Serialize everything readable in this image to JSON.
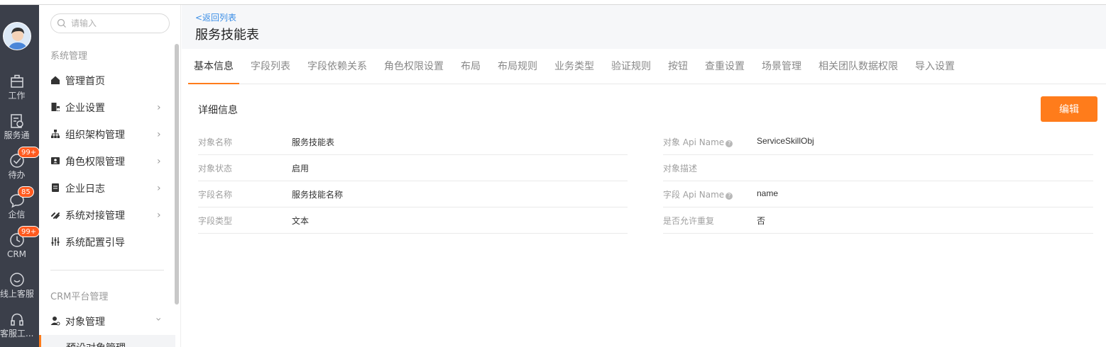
{
  "rail": {
    "items": [
      {
        "label": "工作",
        "icon": "briefcase-icon"
      },
      {
        "label": "服务通",
        "icon": "service-icon"
      },
      {
        "label": "待办",
        "icon": "todo-icon",
        "badge": "99+"
      },
      {
        "label": "企信",
        "icon": "chat-icon",
        "badge": "85"
      },
      {
        "label": "CRM",
        "icon": "crm-icon",
        "badge": "99+"
      },
      {
        "label": "线上客服",
        "icon": "smile-icon"
      },
      {
        "label": "客服工...",
        "icon": "headset-icon"
      }
    ]
  },
  "sidebar": {
    "search_placeholder": "请输入",
    "group1": "系统管理",
    "items": [
      {
        "label": "管理首页",
        "icon": "home-icon"
      },
      {
        "label": "企业设置",
        "icon": "building-icon"
      },
      {
        "label": "组织架构管理",
        "icon": "org-chart-icon"
      },
      {
        "label": "角色权限管理",
        "icon": "id-card-icon"
      },
      {
        "label": "企业日志",
        "icon": "log-icon"
      },
      {
        "label": "系统对接管理",
        "icon": "link-icon"
      },
      {
        "label": "系统配置引导",
        "icon": "sliders-icon"
      }
    ],
    "group2": "CRM平台管理",
    "object_mgmt": "对象管理",
    "sub_item": "预设对象管理"
  },
  "header": {
    "back_label": "<返回列表",
    "title": "服务技能表"
  },
  "tabs": [
    "基本信息",
    "字段列表",
    "字段依赖关系",
    "角色权限设置",
    "布局",
    "布局规则",
    "业务类型",
    "验证规则",
    "按钮",
    "查重设置",
    "场景管理",
    "相关团队数据权限",
    "导入设置"
  ],
  "detail": {
    "section_title": "详细信息",
    "edit_label": "编辑",
    "left": [
      {
        "label": "对象名称",
        "value": "服务技能表"
      },
      {
        "label": "对象状态",
        "value": "启用"
      },
      {
        "label": "字段名称",
        "value": "服务技能名称"
      },
      {
        "label": "字段类型",
        "value": "文本"
      }
    ],
    "right": [
      {
        "label": "对象 Api Name",
        "value": "ServiceSkillObj"
      },
      {
        "label": "对象描述",
        "value": ""
      },
      {
        "label": "字段 Api Name",
        "value": "name"
      },
      {
        "label": "是否允许重复",
        "value": "否"
      }
    ]
  },
  "colors": {
    "accent": "#ff7c1b",
    "link": "#3b8ee6",
    "rail": "#3b3f4a",
    "badge": "#ff5a1f"
  }
}
